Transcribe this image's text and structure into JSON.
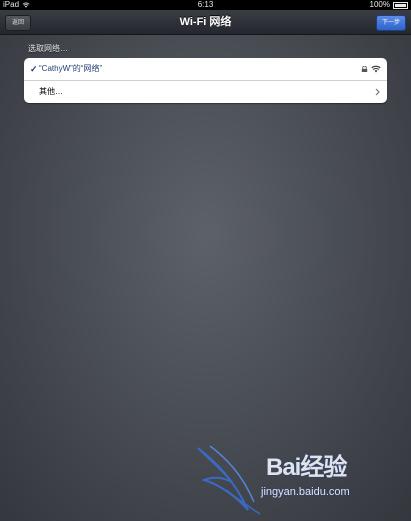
{
  "status_bar": {
    "device": "iPad",
    "time": "6:13",
    "battery": "100%"
  },
  "nav": {
    "title": "Wi-Fi 网络",
    "back_label": "返回",
    "next_label": "下一步"
  },
  "section": {
    "header": "选取网络…"
  },
  "networks": [
    {
      "name": "“CathyW”的“网络”",
      "selected": true,
      "secured": true
    }
  ],
  "other_label": "其他…",
  "watermark": {
    "brand": "Bai经验",
    "url": "jingyan.baidu.com"
  },
  "colors": {
    "selected_text": "#223e72",
    "nav_next": "#2e62c9"
  }
}
